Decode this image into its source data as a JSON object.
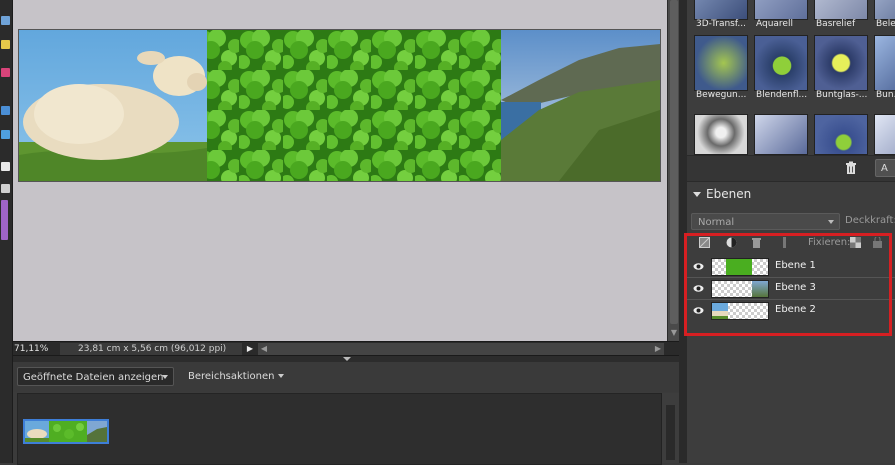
{
  "status_bar": {
    "zoom": "71,11%",
    "document_info": "23,81 cm x 5,56 cm (96,012 ppi)"
  },
  "project_bin": {
    "dropdown_label": "Geöffnete Dateien anzeigen",
    "actions_label": "Bereichsaktionen"
  },
  "effects": {
    "row1": [
      "3D-Transf...",
      "Aquarell",
      "Basrelief",
      "Bele..."
    ],
    "row2": [
      "Bewegun...",
      "Blendenfl...",
      "Buntglas-...",
      "Bun..."
    ],
    "apply_label": "A"
  },
  "layers_panel": {
    "title": "Ebenen",
    "blend_mode": "Normal",
    "opacity_label": "Deckkraft:",
    "lock_label": "Fixieren:",
    "layers": [
      {
        "name": "Ebene 1",
        "thumb": "clover"
      },
      {
        "name": "Ebene 3",
        "thumb": "coast"
      },
      {
        "name": "Ebene 2",
        "thumb": "sheep"
      }
    ]
  },
  "colors": {
    "canvas_bg": "#c6c3c8",
    "panel_bg": "#3d3d3d",
    "highlight": "#d71f22",
    "selection": "#3e7ed7"
  },
  "icons": [
    "visibility-eye-icon",
    "trash-icon",
    "new-layer-icon",
    "adjustment-layer-icon",
    "delete-layer-icon",
    "lock-icon"
  ]
}
